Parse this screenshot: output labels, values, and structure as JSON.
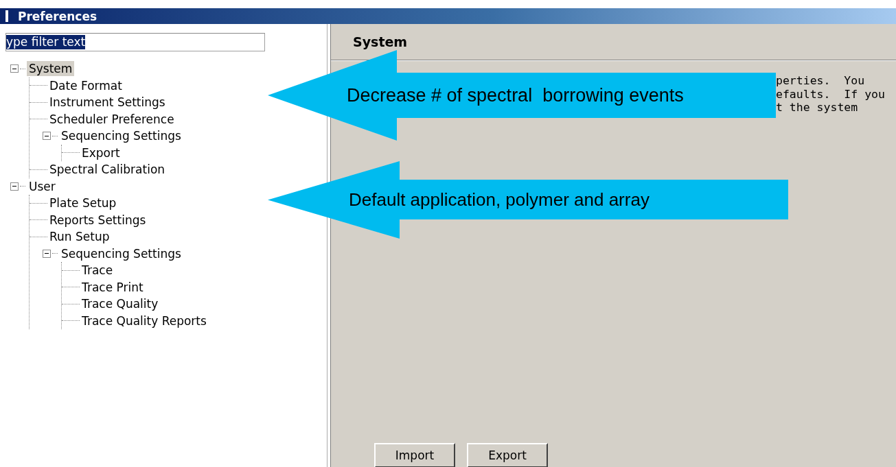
{
  "window": {
    "title": "Preferences"
  },
  "filter": {
    "value": "ype filter text",
    "selected": true
  },
  "tree": [
    {
      "label": "System",
      "selected": true,
      "expanded": true,
      "children": [
        {
          "label": "Date Format",
          "selected": false
        },
        {
          "label": "Instrument Settings",
          "selected": false
        },
        {
          "label": "Scheduler Preference",
          "selected": false
        },
        {
          "label": "Sequencing Settings",
          "selected": false,
          "expanded": true,
          "children": [
            {
              "label": "Export",
              "selected": false
            }
          ]
        },
        {
          "label": "Spectral Calibration",
          "selected": false
        }
      ]
    },
    {
      "label": "User",
      "selected": false,
      "expanded": true,
      "children": [
        {
          "label": "Plate Setup",
          "selected": false
        },
        {
          "label": "Reports Settings",
          "selected": false
        },
        {
          "label": "Run Setup",
          "selected": false
        },
        {
          "label": "Sequencing Settings",
          "selected": false,
          "expanded": true,
          "children": [
            {
              "label": "Trace",
              "selected": false
            },
            {
              "label": "Trace Print",
              "selected": false
            },
            {
              "label": "Trace Quality",
              "selected": false
            },
            {
              "label": "Trace Quality Reports",
              "selected": false
            }
          ]
        }
      ]
    }
  ],
  "page": {
    "title": "System",
    "description": [
      "perties.  You",
      "efaults.  If you",
      "t the system"
    ]
  },
  "buttons": [
    "Import",
    "Export"
  ],
  "callouts": [
    {
      "text": "Decrease # of spectral  borrowing events"
    },
    {
      "text": "Default application, polymer and array"
    }
  ]
}
